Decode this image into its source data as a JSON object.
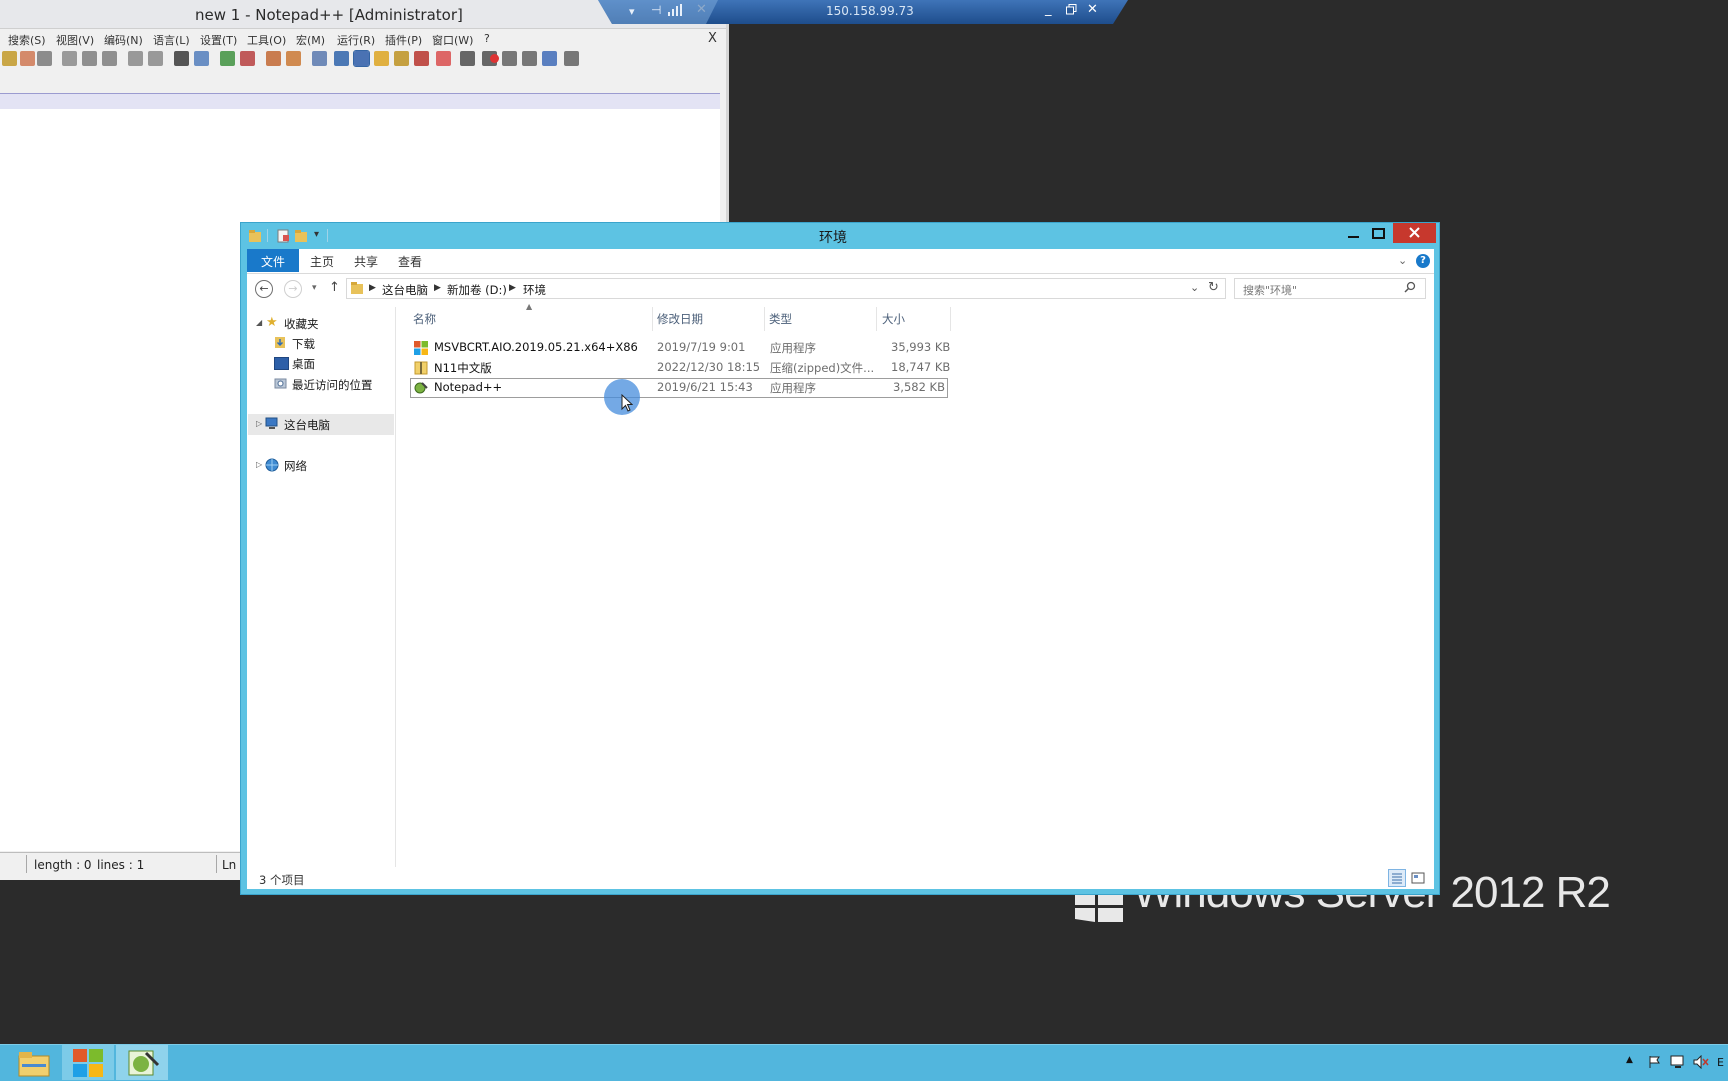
{
  "brand": {
    "text": "Windows Server 2012 R2"
  },
  "notepad": {
    "title": "new 1 - Notepad++ [Administrator]",
    "menu": [
      "搜索(S)",
      "视图(V)",
      "编码(N)",
      "语言(L)",
      "设置(T)",
      "工具(O)",
      "宏(M)",
      "运行(R)",
      "插件(P)",
      "窗口(W)",
      "?"
    ],
    "close_glyph": "X",
    "status": {
      "length": "length : 0",
      "lines": "lines : 1",
      "ln": "Ln :"
    }
  },
  "rdp": {
    "host": "150.158.99.73"
  },
  "explorer": {
    "title": "环境",
    "ribbon_tabs": {
      "file": "文件",
      "home": "主页",
      "share": "共享",
      "view": "查看"
    },
    "breadcrumb": [
      "这台电脑",
      "新加卷 (D:)",
      "环境"
    ],
    "search_placeholder": "搜索\"环境\"",
    "nav": {
      "favorites": "收藏夹",
      "downloads": "下载",
      "desktop": "桌面",
      "recent": "最近访问的位置",
      "this_pc": "这台电脑",
      "network": "网络"
    },
    "columns": [
      "名称",
      "修改日期",
      "类型",
      "大小"
    ],
    "files": [
      {
        "name": "MSVBCRT.AIO.2019.05.21.x64+X86",
        "date": "2019/7/19 9:01",
        "type": "应用程序",
        "size": "35,993 KB"
      },
      {
        "name": "N11中文版",
        "date": "2022/12/30 18:15",
        "type": "压缩(zipped)文件...",
        "size": "18,747 KB"
      },
      {
        "name": "Notepad++",
        "date": "2019/6/21 15:43",
        "type": "应用程序",
        "size": "3,582 KB"
      }
    ],
    "status_text": "3 个项目"
  },
  "tray": {
    "lang": "E"
  },
  "colors": {
    "explorer_frame": "#5dc3e3",
    "ribbon_file_tab": "#1979ca",
    "taskbar": "#52b6dd",
    "desktop": "#2b2b2b",
    "close_button": "#c7382d"
  }
}
